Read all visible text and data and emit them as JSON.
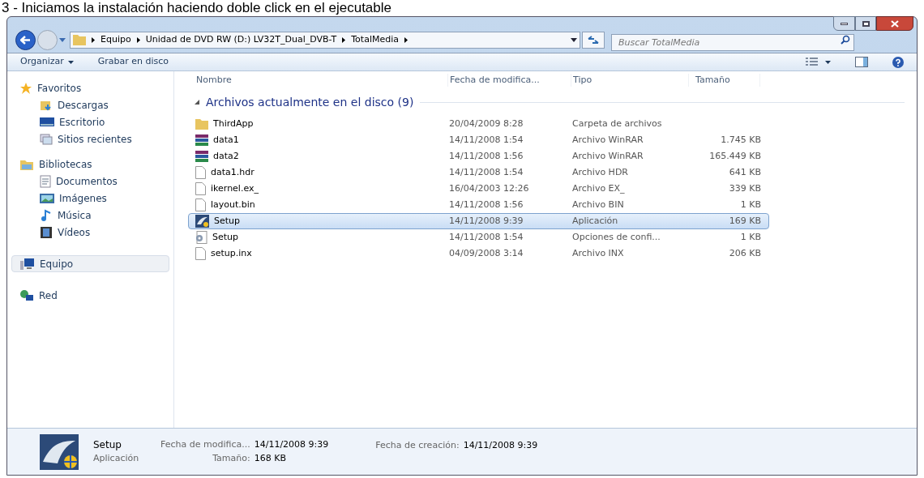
{
  "caption": "3 - Iniciamos la instalación haciendo doble click en el ejecutable",
  "breadcrumb": [
    "Equipo",
    "Unidad de DVD RW (D:) LV32T_Dual_DVB-T",
    "TotalMedia"
  ],
  "search": {
    "placeholder": "Buscar TotalMedia"
  },
  "toolbar": [
    "Organizar",
    "Grabar en disco"
  ],
  "sidebar": [
    {
      "label": "Favoritos",
      "kind": "star",
      "selected": false,
      "children": [
        {
          "label": "Descargas",
          "kind": "download",
          "selected": false
        },
        {
          "label": "Escritorio",
          "kind": "desktop",
          "selected": false
        },
        {
          "label": "Sitios recientes",
          "kind": "recent",
          "selected": false
        }
      ]
    },
    {
      "label": "Bibliotecas",
      "kind": "library",
      "selected": false,
      "children": [
        {
          "label": "Documentos",
          "kind": "document",
          "selected": false
        },
        {
          "label": "Imágenes",
          "kind": "image",
          "selected": false
        },
        {
          "label": "Música",
          "kind": "music",
          "selected": false
        },
        {
          "label": "Vídeos",
          "kind": "video",
          "selected": false
        }
      ]
    },
    {
      "label": "Equipo",
      "kind": "computer",
      "selected": true
    },
    {
      "label": "Red",
      "kind": "network",
      "selected": false
    }
  ],
  "columns": [
    "Nombre",
    "Fecha de modifica...",
    "Tipo",
    "Tamaño"
  ],
  "group": "Archivos actualmente en el disco (9)",
  "rows": [
    {
      "name": "ThirdApp",
      "kind": "folder",
      "date": "20/04/2009 8:28",
      "type": "Carpeta de archivos",
      "selected": false
    },
    {
      "name": "data1",
      "kind": "archive",
      "date": "14/11/2008 1:54",
      "type": "Archivo WinRAR",
      "size": "1.745 KB",
      "selected": false
    },
    {
      "name": "data2",
      "kind": "archive",
      "date": "14/11/2008 1:56",
      "type": "Archivo WinRAR",
      "size": "165.449 KB",
      "selected": false
    },
    {
      "name": "data1.hdr",
      "kind": "file",
      "date": "14/11/2008 1:54",
      "type": "Archivo HDR",
      "size": "641 KB",
      "selected": false
    },
    {
      "name": "ikernel.ex_",
      "kind": "file",
      "date": "16/04/2003 12:26",
      "type": "Archivo EX_",
      "size": "339 KB",
      "selected": false
    },
    {
      "name": "layout.bin",
      "kind": "file",
      "date": "14/11/2008 1:56",
      "type": "Archivo BIN",
      "size": "1 KB",
      "selected": false
    },
    {
      "name": "Setup",
      "kind": "app",
      "date": "14/11/2008 9:39",
      "type": "Aplicación",
      "size": "169 KB",
      "selected": true
    },
    {
      "name": "Setup",
      "kind": "config",
      "date": "14/11/2008 1:54",
      "type": "Opciones de confi...",
      "size": "1 KB",
      "selected": false
    },
    {
      "name": "setup.inx",
      "kind": "file",
      "date": "04/09/2008 3:14",
      "type": "Archivo INX",
      "size": "206 KB",
      "selected": false
    }
  ],
  "details": {
    "name": "Setup",
    "type": "Aplicación",
    "fields": [
      {
        "label": "Fecha de modifica...",
        "value": "14/11/2008 9:39"
      },
      {
        "label": "Tamaño:",
        "value": "168 KB"
      },
      {
        "label": "Fecha de creación:",
        "value": "14/11/2008 9:39"
      }
    ]
  }
}
